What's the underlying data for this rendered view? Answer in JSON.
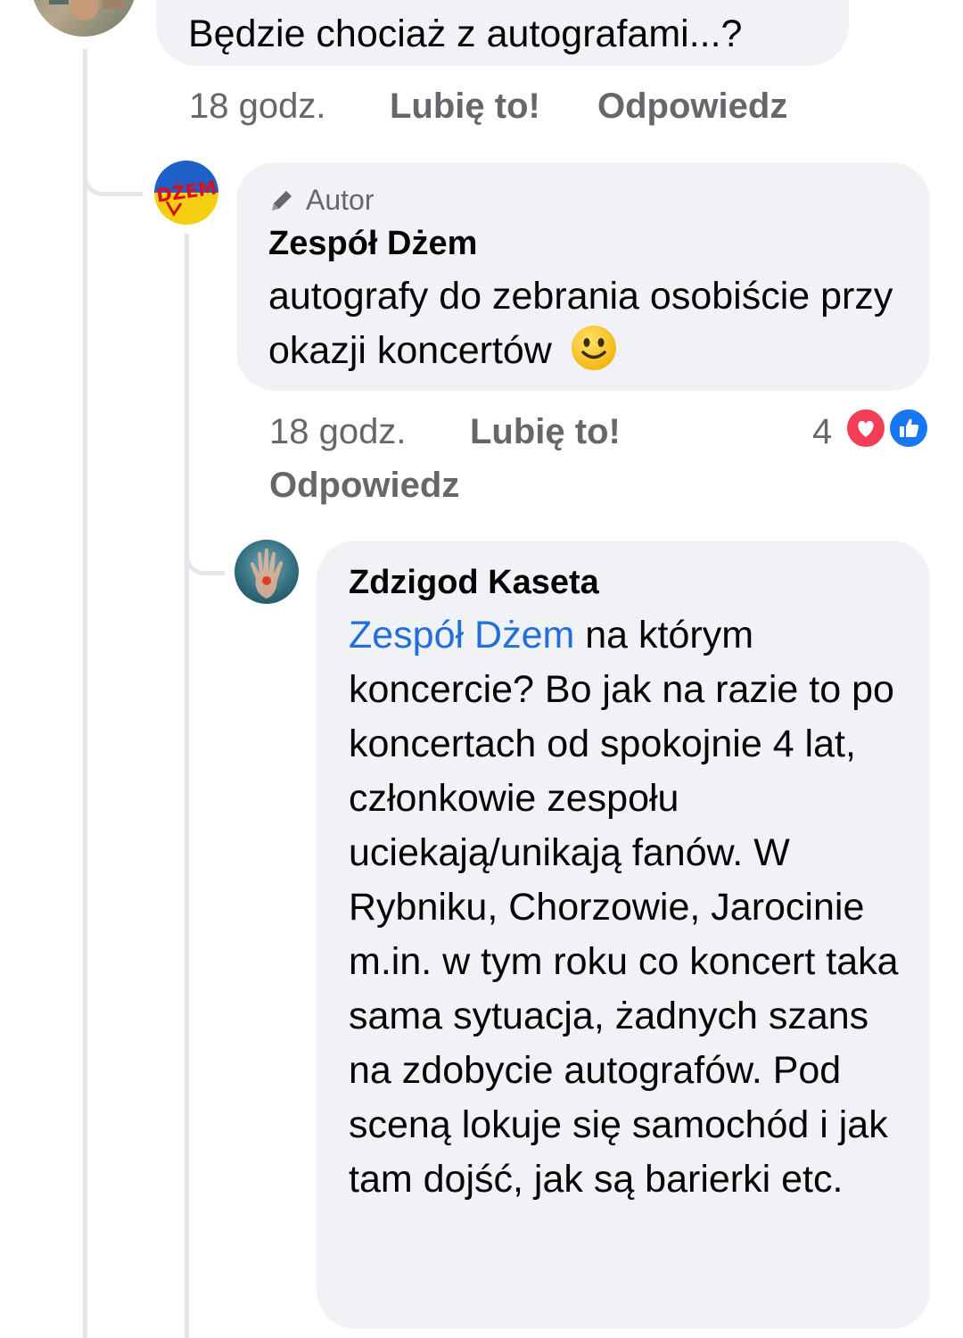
{
  "comment1": {
    "text": "Będzie chociaż z autografami...?",
    "time": "18 godz.",
    "like_label": "Lubię to!",
    "reply_label": "Odpowiedz"
  },
  "comment2": {
    "badge": "Autor",
    "author": "Zespół Dżem",
    "text": "autografy do zebrania osobiście przy okazji koncertów",
    "emoji": "🙂",
    "time": "18 godz.",
    "like_label": "Lubię to!",
    "reply_label": "Odpowiedz",
    "reaction_count": "4",
    "reactions": [
      "heart-icon",
      "like-icon"
    ],
    "avatar_logo_text": "DŻEM"
  },
  "comment3": {
    "author": "Zdzigod Kaseta",
    "mention": "Zespół Dżem",
    "text": " na którym koncercie? Bo jak na razie to po koncertach od spokojnie 4 lat, członkowie zespołu uciekają/unikają fanów. W Rybniku, Chorzowie, Jarocinie m.in. w tym roku co koncert taka sama sytuacja, żadnych szans na zdobycie autografów. Pod sceną lokuje się samochód i jak tam dojść, jak są barierki etc."
  },
  "colors": {
    "bubble": "#f0f2f5",
    "meta": "#65676b",
    "mention": "#216fdb",
    "heart": "#f33e58",
    "like": "#1877f2",
    "thread": "#e4e6eb"
  }
}
